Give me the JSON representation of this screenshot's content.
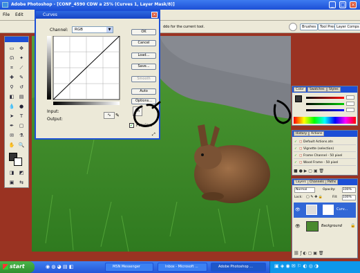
{
  "window": {
    "title": "Adobe Photoshop - [CONF_4590 CDW a 25% (Curves 1, Layer Mask/8)]",
    "controls": [
      "_",
      "□",
      "×"
    ]
  },
  "menubar": {
    "items": [
      "File",
      "Edit"
    ]
  },
  "options_bar": {
    "hint": "ddo for the current tool.",
    "buttons": [
      "Brushes",
      "Tool Presets",
      "Layer Comps"
    ]
  },
  "curves_dialog": {
    "title": "Curves",
    "close": "×",
    "channel_label": "Channel:",
    "channel_value": "RGB",
    "input_label": "Input:",
    "output_label": "Output:",
    "buttons": [
      "OK",
      "Cancel",
      "Load...",
      "Save...",
      "Smooth",
      "Auto",
      "Options..."
    ],
    "preview_label": "Preview",
    "preview_checked": true
  },
  "color_panel": {
    "tabs": [
      "Color",
      "Swatches",
      "Styles"
    ]
  },
  "history_panel": {
    "tabs": [
      "History",
      "Actions"
    ],
    "actions": [
      "Default Actions.atn",
      "Vignette (selection)",
      "Frame Channel - 50 pixel",
      "Wood Frame - 50 pixel"
    ]
  },
  "layers_panel": {
    "tabs": [
      "Layers",
      "Channels",
      "Paths"
    ],
    "mode": "Normal",
    "opacity_label": "Opacity:",
    "opacity_value": "100%",
    "lock_label": "Lock:",
    "fill_label": "Fill:",
    "fill_value": "100%",
    "layers": [
      {
        "name": "Curv...",
        "selected": true
      },
      {
        "name": "Background",
        "selected": false
      }
    ]
  },
  "taskbar": {
    "start_label": "start",
    "tasks": [
      "MSN Messenger",
      "Inbox - Microsoft ...",
      "Adobe Photoshop ..."
    ]
  },
  "colors": {
    "title_blue": "#1c4fd6",
    "canvas_bg": "#9a3322",
    "grass": "#3c8a28",
    "panel": "#ece9d8"
  }
}
